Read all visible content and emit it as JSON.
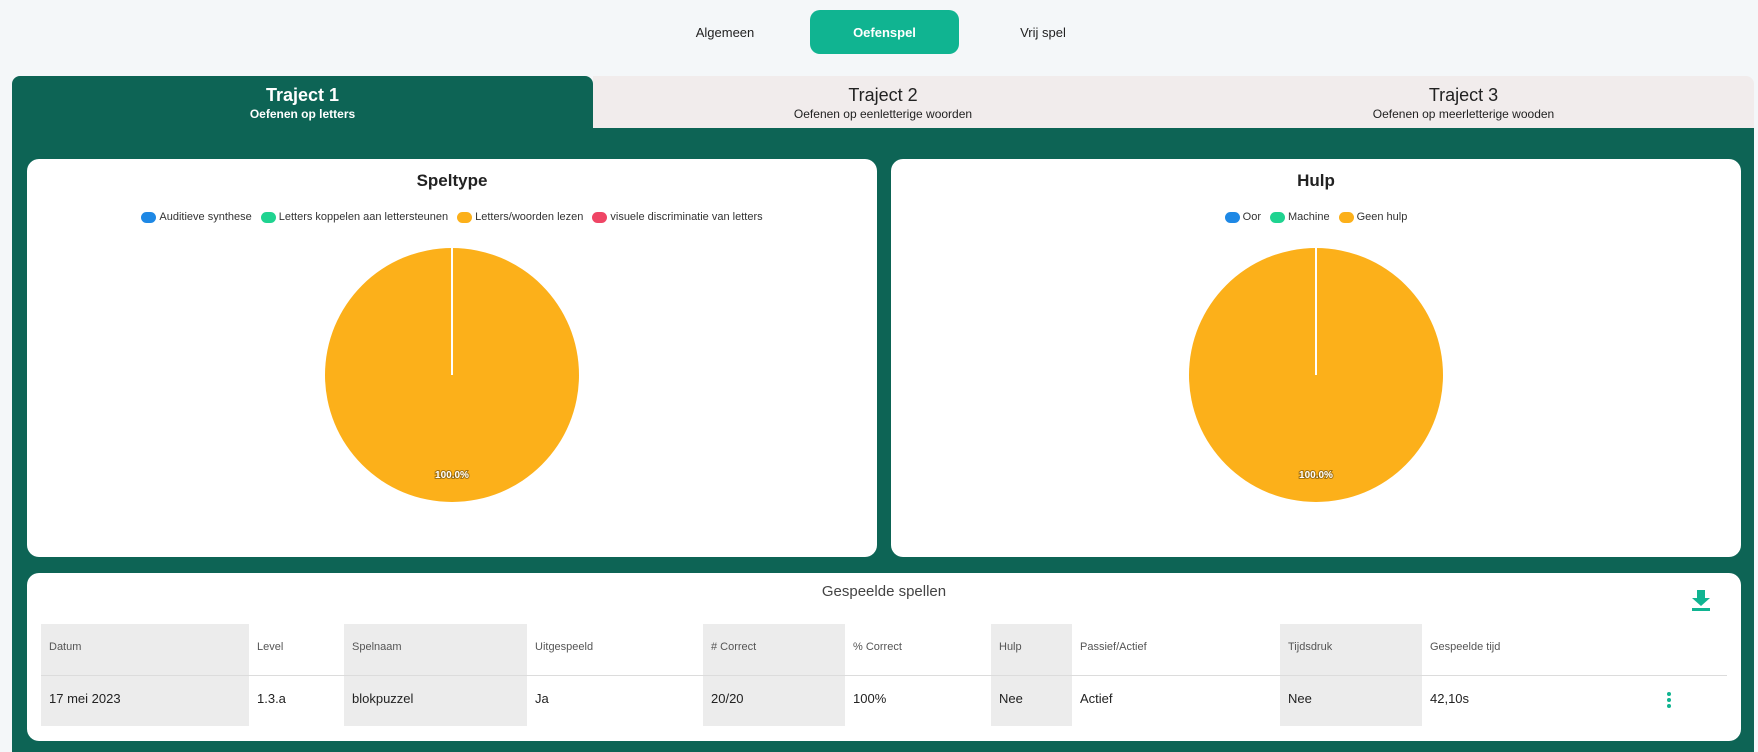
{
  "nav": {
    "tabs": [
      {
        "label": "Algemeen",
        "active": false
      },
      {
        "label": "Oefenspel",
        "active": true
      },
      {
        "label": "Vrij spel",
        "active": false
      }
    ]
  },
  "trajects": [
    {
      "title": "Traject 1",
      "subtitle": "Oefenen op letters",
      "active": true
    },
    {
      "title": "Traject 2",
      "subtitle": "Oefenen op eenletterige woorden",
      "active": false
    },
    {
      "title": "Traject 3",
      "subtitle": "Oefenen op meerletterige wooden",
      "active": false
    }
  ],
  "colors": {
    "accent": "#10b491",
    "panel": "#0d6455",
    "blue": "#1e88e5",
    "green": "#1fd390",
    "orange": "#fcb01a",
    "red": "#ef4565"
  },
  "chart_data": [
    {
      "type": "pie",
      "title": "Speltype",
      "categories": [
        "Auditieve synthese",
        "Letters koppelen aan lettersteunen",
        "Letters/woorden lezen",
        "visuele discriminatie van letters"
      ],
      "values": [
        0,
        0,
        100,
        0
      ],
      "colors": [
        "#1e88e5",
        "#1fd390",
        "#fcb01a",
        "#ef4565"
      ],
      "data_labels": [
        "",
        "",
        "100.0%",
        ""
      ],
      "legend": "top"
    },
    {
      "type": "pie",
      "title": "Hulp",
      "categories": [
        "Oor",
        "Machine",
        "Geen hulp"
      ],
      "values": [
        0,
        0,
        100
      ],
      "colors": [
        "#1e88e5",
        "#1fd390",
        "#fcb01a"
      ],
      "data_labels": [
        "",
        "",
        "100.0%"
      ],
      "legend": "top"
    }
  ],
  "table": {
    "title": "Gespeelde spellen",
    "columns": [
      "Datum",
      "Level",
      "Spelnaam",
      "Uitgespeeld",
      "# Correct",
      "% Correct",
      "Hulp",
      "Passief/Actief",
      "Tijdsdruk",
      "Gespeelde tijd"
    ],
    "rows": [
      [
        "17 mei 2023",
        "1.3.a",
        "blokpuzzel",
        "Ja",
        "20/20",
        "100%",
        "Nee",
        "Actief",
        "Nee",
        "42,10s"
      ]
    ]
  }
}
